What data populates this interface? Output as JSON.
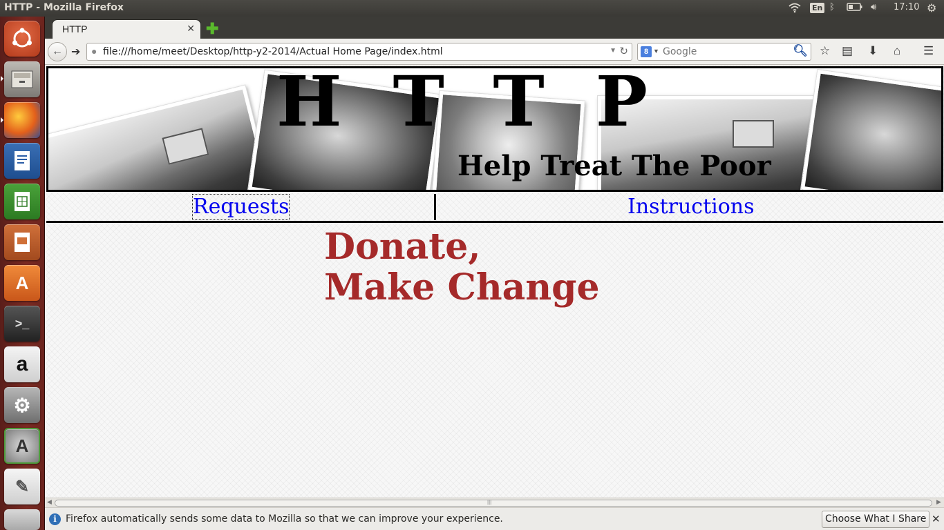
{
  "system": {
    "window_title": "HTTP - Mozilla Firefox",
    "keyboard_layout": "En",
    "clock": "17:10"
  },
  "launcher": {
    "items": [
      "ubuntu-dash-icon",
      "files-icon",
      "firefox-icon",
      "writer-icon",
      "calc-icon",
      "impress-icon",
      "software-center-icon",
      "terminal-icon",
      "amazon-icon",
      "system-settings-icon",
      "software-updater-icon",
      "text-editor-icon",
      "trash-icon"
    ]
  },
  "browser": {
    "tab_title": "HTTP",
    "url": "file:///home/meet/Desktop/http-y2-2014/Actual Home Page/index.html",
    "search_placeholder": "Google",
    "search_engine_letter": "8"
  },
  "page": {
    "banner_title": "HTTP",
    "banner_subtitle": "Help Treat The Poor",
    "menu": {
      "requests": "Requests",
      "instructions": "Instructions"
    },
    "hero_line1": "Donate,",
    "hero_line2": "Make Change",
    "hero_color": "#a52a2a",
    "link_color": "#0000ee"
  },
  "notification": {
    "text": "Firefox automatically sends some data to Mozilla so that we can improve your experience.",
    "button": "Choose What I Share"
  }
}
